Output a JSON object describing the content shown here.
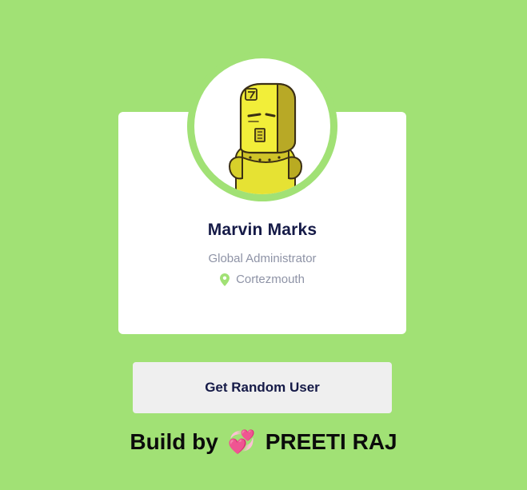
{
  "user": {
    "name": "Marvin Marks",
    "title": "Global Administrator",
    "location": "Cortezmouth",
    "avatar_icon": "yellow-robot-avatar"
  },
  "actions": {
    "random_user_label": "Get Random User"
  },
  "footer": {
    "prefix": "Build by",
    "emoji": "💞",
    "author": "PREETI RAJ"
  },
  "colors": {
    "background": "#a1e175",
    "card": "#ffffff",
    "name": "#151a47",
    "muted": "#8e93a6",
    "pin": "#a1e175",
    "button": "#efefef"
  }
}
